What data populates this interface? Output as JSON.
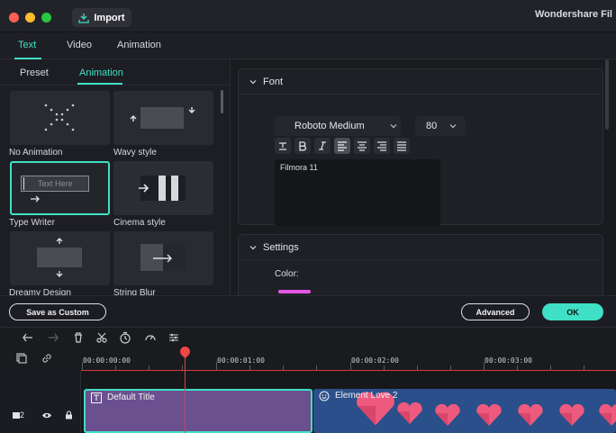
{
  "window": {
    "title": "Wondershare Fil",
    "import_label": "Import"
  },
  "top_tabs": [
    {
      "label": "Text",
      "active": true
    },
    {
      "label": "Video",
      "active": false
    },
    {
      "label": "Animation",
      "active": false
    }
  ],
  "left_panel": {
    "sub_tabs": [
      {
        "label": "Preset",
        "active": false
      },
      {
        "label": "Animation",
        "active": true
      }
    ],
    "presets": [
      {
        "label": "No Animation"
      },
      {
        "label": "Wavy style"
      },
      {
        "label": "Type Writer",
        "preview_text": "Text Here",
        "selected": true
      },
      {
        "label": "Cinema style"
      },
      {
        "label": "Dreamy Design"
      },
      {
        "label": "String Blur"
      }
    ]
  },
  "font_section": {
    "title": "Font",
    "font_name": "Roboto Medium",
    "font_size": "80",
    "text_value": "Filmora 11",
    "format_buttons": [
      "text-style",
      "bold",
      "italic",
      "align-left",
      "align-center",
      "align-right",
      "justify"
    ]
  },
  "settings_section": {
    "title": "Settings",
    "color_label": "Color:",
    "color_value": "#e657e6"
  },
  "actions": {
    "save_custom": "Save as Custom",
    "advanced": "Advanced",
    "ok": "OK"
  },
  "timeline": {
    "timecodes": [
      "00:00:00:00",
      "00:00:01:00",
      "00:00:02:00",
      "00:00:03:00"
    ],
    "track_number": "2",
    "clips": [
      {
        "label": "Default Title"
      },
      {
        "label": "Element Love 2"
      }
    ]
  },
  "colors": {
    "accent": "#3fe0c5",
    "playhead": "#e04141",
    "title_clip": "#6b5090",
    "element_clip": "#2a4f8a"
  }
}
